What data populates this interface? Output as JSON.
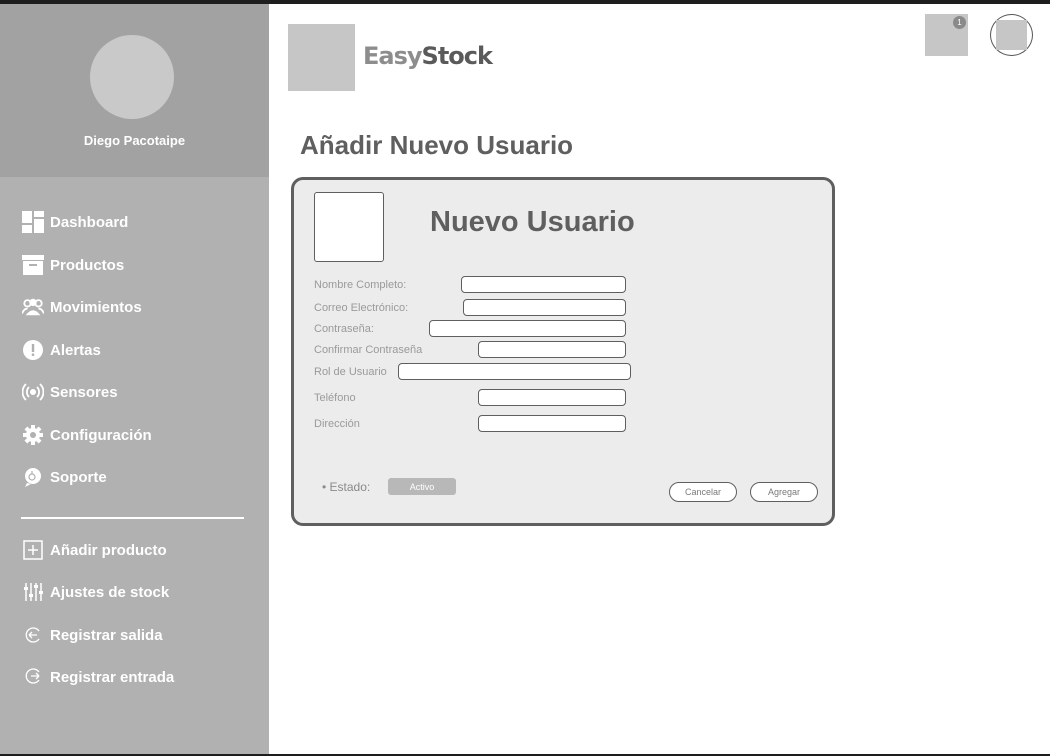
{
  "user": {
    "name": "Diego Pacotaipe"
  },
  "sidebar": {
    "items": [
      {
        "label": "Dashboard",
        "icon": "dashboard-icon"
      },
      {
        "label": "Productos",
        "icon": "archive-box-icon"
      },
      {
        "label": "Movimientos",
        "icon": "users-icon"
      },
      {
        "label": "Alertas",
        "icon": "alert-icon"
      },
      {
        "label": "Sensores",
        "icon": "sensor-icon"
      },
      {
        "label": "Configuración",
        "icon": "gear-icon"
      },
      {
        "label": "Soporte",
        "icon": "support-icon"
      }
    ],
    "actions": [
      {
        "label": "Añadir producto",
        "icon": "plus-square-icon"
      },
      {
        "label": "Ajustes de stock",
        "icon": "sliders-icon"
      },
      {
        "label": "Registrar salida",
        "icon": "exit-icon"
      },
      {
        "label": "Registrar entrada",
        "icon": "enter-icon"
      }
    ]
  },
  "header": {
    "brand_part1": "Easy",
    "brand_part2": "Stock",
    "notifications_count": "1"
  },
  "page": {
    "title": "Añadir Nuevo Usuario"
  },
  "form": {
    "title": "Nuevo Usuario",
    "fields": [
      {
        "label": "Nombre Completo:",
        "value": ""
      },
      {
        "label": "Correo Electrónico:",
        "value": ""
      },
      {
        "label": "Contraseña:",
        "value": ""
      },
      {
        "label": "Confirmar Contraseña",
        "value": ""
      },
      {
        "label": "Rol de Usuario",
        "value": ""
      },
      {
        "label": "Teléfono",
        "value": ""
      },
      {
        "label": "Dirección",
        "value": ""
      }
    ],
    "status_label": "• Estado:",
    "status_value": "Activo",
    "cancel_label": "Cancelar",
    "add_label": "Agregar"
  },
  "colors": {
    "sidebar_bg": "#b1b1b1",
    "profile_bg": "#a2a2a2",
    "card_bg": "#ececec",
    "text_dark": "#5f5f5f"
  }
}
